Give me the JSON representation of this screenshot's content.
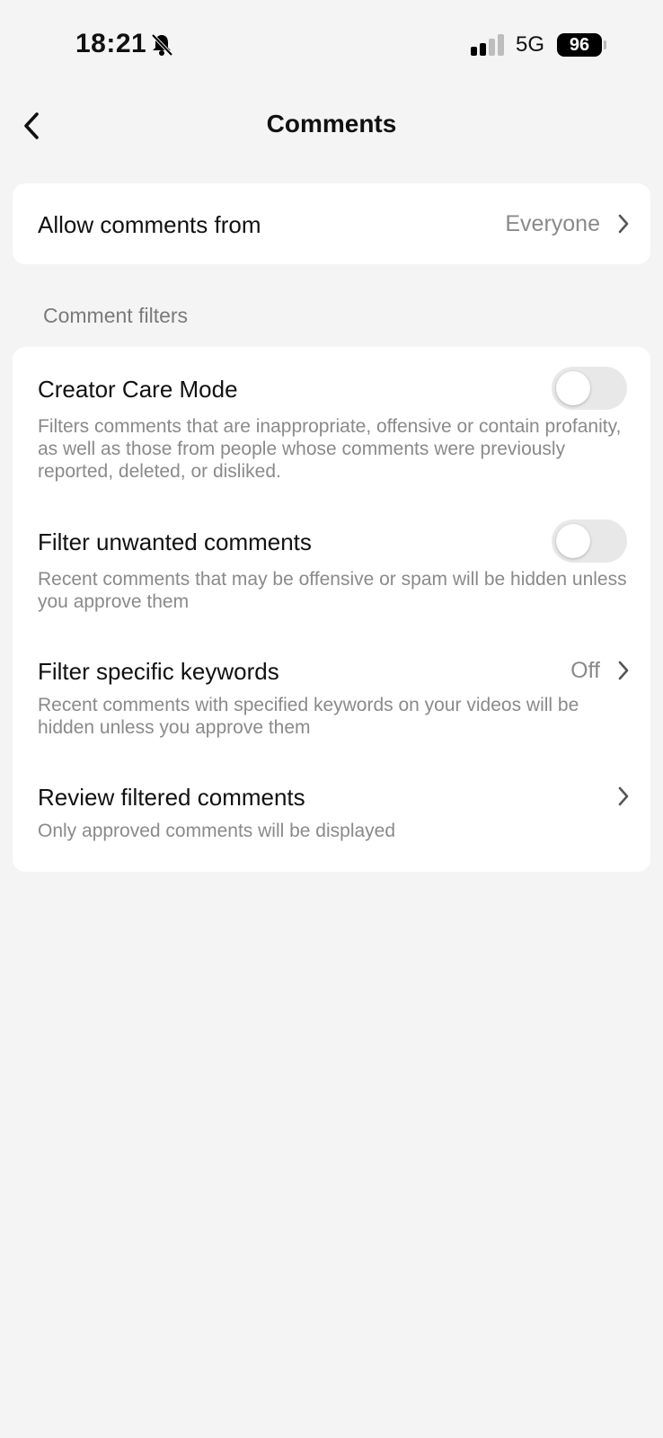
{
  "status_bar": {
    "time": "18:21",
    "network": "5G",
    "battery": "96",
    "icons": [
      "bell-slash-icon",
      "signal-icon",
      "battery-icon"
    ]
  },
  "header": {
    "title": "Comments",
    "back_icon": "chevron-left-icon"
  },
  "allow_comments": {
    "label": "Allow comments from",
    "value": "Everyone"
  },
  "filters": {
    "section_title": "Comment filters",
    "creator_care": {
      "title": "Creator Care Mode",
      "description": "Filters comments that are inappropriate, offensive or contain profanity, as well as those from people whose comments were previously reported, deleted, or disliked.",
      "enabled": false
    },
    "unwanted": {
      "title": "Filter unwanted comments",
      "description": "Recent comments that may be offensive or spam will be hidden unless you approve them",
      "enabled": false
    },
    "keywords": {
      "title": "Filter specific keywords",
      "value": "Off",
      "description": "Recent comments with specified keywords on your videos will be hidden unless you approve them"
    },
    "review": {
      "title": "Review filtered comments",
      "description": "Only approved comments will be displayed"
    }
  },
  "colors": {
    "background": "#f4f4f4",
    "card": "#ffffff",
    "secondary_text": "#8a8a8a",
    "toggle_off": "#e8e8e8"
  }
}
